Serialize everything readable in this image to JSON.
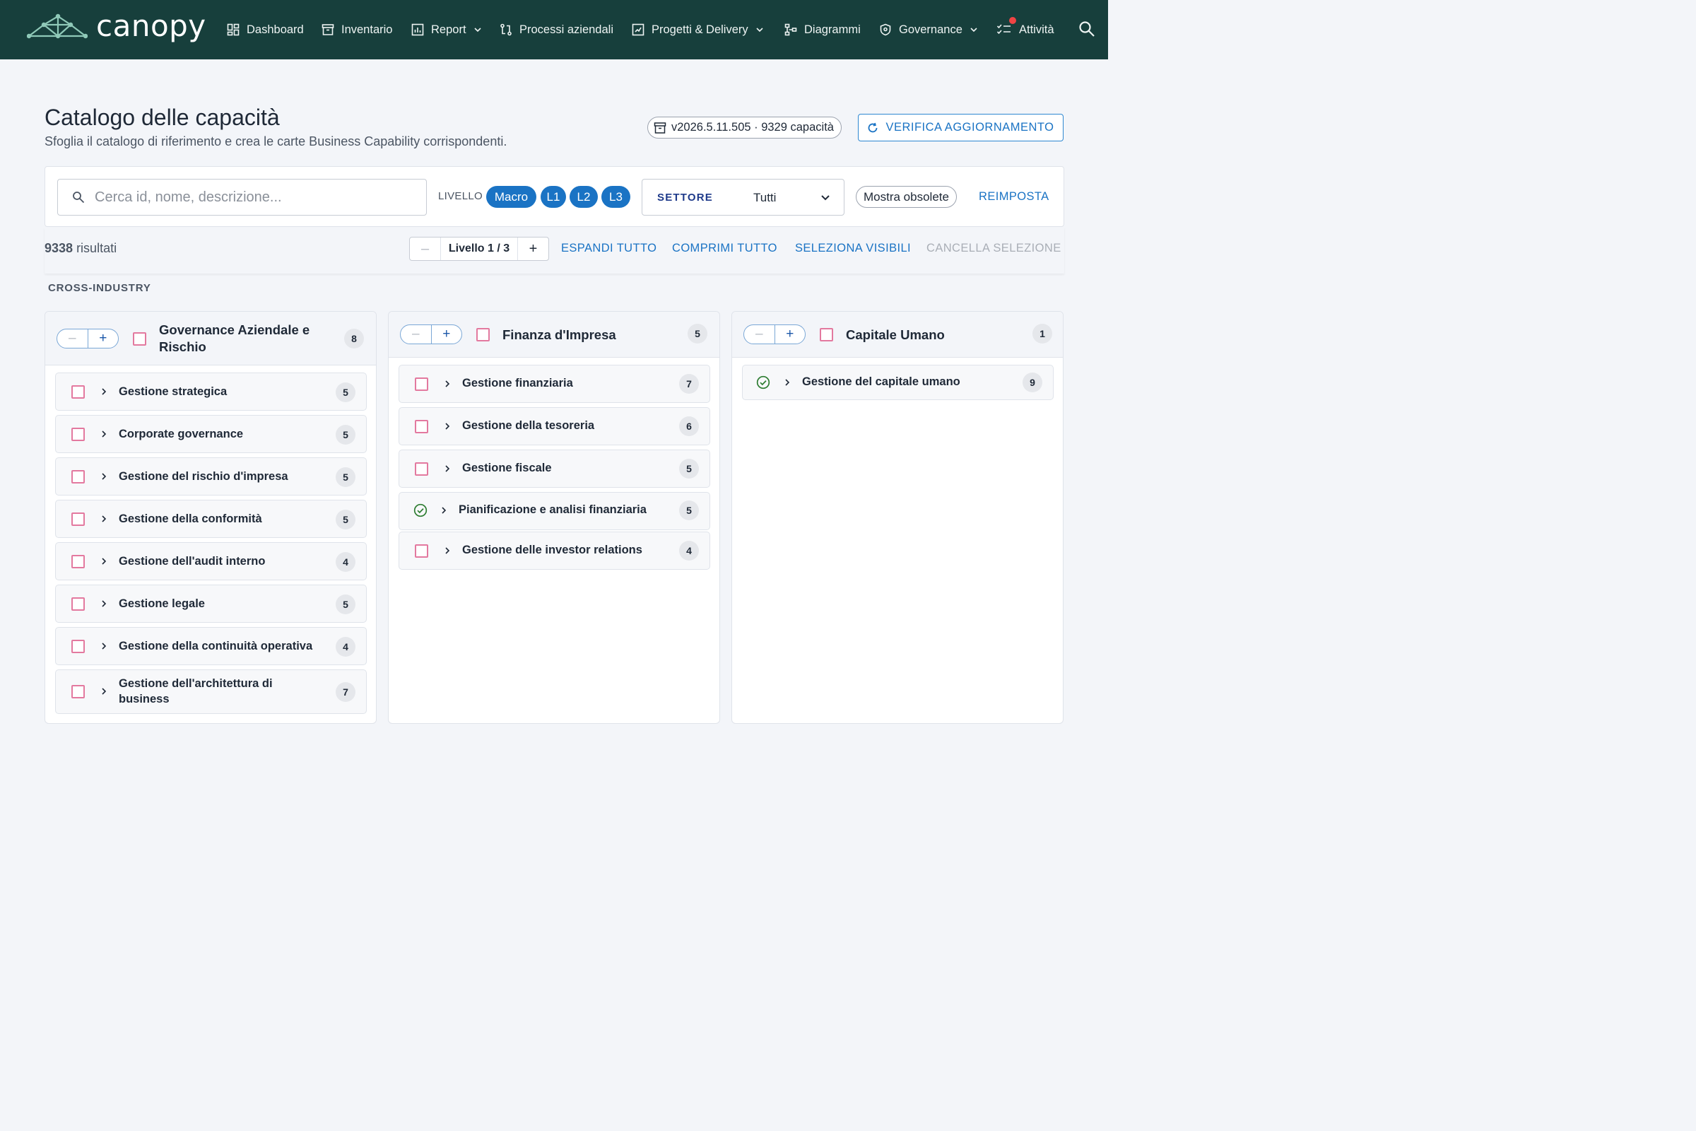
{
  "app": {
    "logo_text": "canopy",
    "nav": [
      {
        "label": "Dashboard",
        "icon": "dashboard-icon"
      },
      {
        "label": "Inventario",
        "icon": "archive-icon"
      },
      {
        "label": "Report",
        "icon": "bar-chart-icon",
        "dropdown": true
      },
      {
        "label": "Processi aziendali",
        "icon": "process-icon"
      },
      {
        "label": "Progetti & Delivery",
        "icon": "project-icon",
        "dropdown": true
      },
      {
        "label": "Diagrammi",
        "icon": "diagram-icon"
      },
      {
        "label": "Governance",
        "icon": "shield-icon",
        "dropdown": true
      },
      {
        "label": "Attività",
        "icon": "checklist-icon",
        "has_notification": true
      }
    ],
    "notification_color": "#ef4444"
  },
  "page": {
    "title": "Catalogo delle capacità",
    "subtitle": "Sfoglia il catalogo di riferimento e crea le carte Business Capability corrispondenti.",
    "version": "v2026.5.11.505 · 9329 capacità",
    "verify_button": "VERIFICA AGGIORNAMENTO"
  },
  "filters": {
    "search_placeholder": "Cerca id, nome, descrizione...",
    "search_value": "",
    "level_label": "LIVELLO",
    "levels": [
      "Macro",
      "L1",
      "L2",
      "L3"
    ],
    "sector_label": "SETTORE",
    "sector_value": "Tutti",
    "show_obsolete": "Mostra obsolete",
    "reset": "REIMPOSTA"
  },
  "toolbar": {
    "result_count": "9338",
    "result_label": "risultati",
    "level_stepper": "Livello 1 / 3",
    "expand_all": "ESPANDI TUTTO",
    "collapse_all": "COMPRIMI TUTTO",
    "select_visible": "SELEZIONA VISIBILI",
    "clear_selection": "CANCELLA SELEZIONE"
  },
  "section": {
    "label": "CROSS-INDUSTRY"
  },
  "columns": [
    {
      "title": "Governance Aziendale e Rischio",
      "count": "8",
      "items": [
        {
          "label": "Gestione strategica",
          "count": "5",
          "status": "unchecked"
        },
        {
          "label": "Corporate governance",
          "count": "5",
          "status": "unchecked"
        },
        {
          "label": "Gestione del rischio d'impresa",
          "count": "5",
          "status": "unchecked"
        },
        {
          "label": "Gestione della conformità",
          "count": "5",
          "status": "unchecked"
        },
        {
          "label": "Gestione dell'audit interno",
          "count": "4",
          "status": "unchecked"
        },
        {
          "label": "Gestione legale",
          "count": "5",
          "status": "unchecked"
        },
        {
          "label": "Gestione della continuità operativa",
          "count": "4",
          "status": "unchecked"
        },
        {
          "label": "Gestione dell'architettura di business",
          "count": "7",
          "status": "unchecked"
        }
      ]
    },
    {
      "title": "Finanza d'Impresa",
      "count": "5",
      "items": [
        {
          "label": "Gestione finanziaria",
          "count": "7",
          "status": "unchecked"
        },
        {
          "label": "Gestione della tesoreria",
          "count": "6",
          "status": "unchecked"
        },
        {
          "label": "Gestione fiscale",
          "count": "5",
          "status": "unchecked"
        },
        {
          "label": "Pianificazione e analisi finanziaria",
          "count": "5",
          "status": "existing"
        },
        {
          "label": "Gestione delle investor relations",
          "count": "4",
          "status": "unchecked"
        }
      ]
    },
    {
      "title": "Capitale Umano",
      "count": "1",
      "items": [
        {
          "label": "Gestione del capitale umano",
          "count": "9",
          "status": "existing"
        }
      ]
    }
  ],
  "colors": {
    "nav_bg": "#173f3c",
    "accent": "#1a73c4",
    "checkbox_border": "#e3799f",
    "existing_check": "#2e7d32"
  }
}
